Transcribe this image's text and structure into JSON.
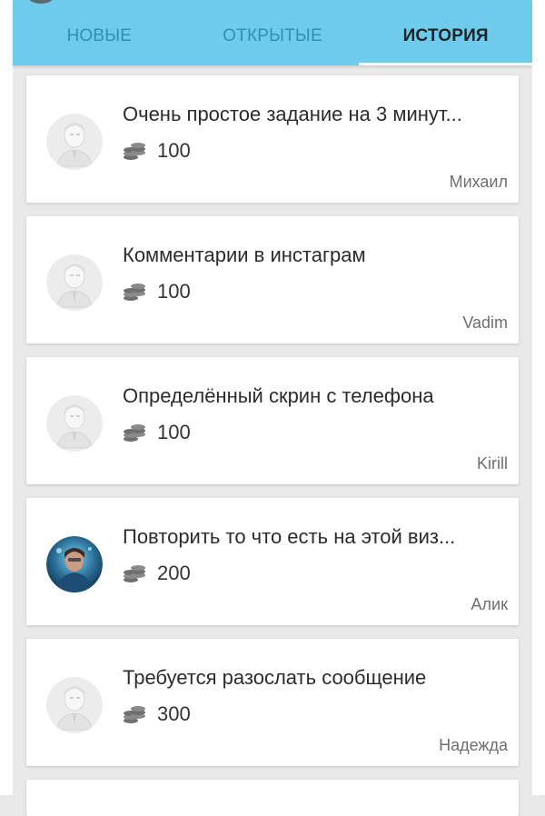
{
  "tabs": [
    {
      "label": "НОВЫЕ",
      "active": false
    },
    {
      "label": "ОТКРЫТЫЕ",
      "active": false
    },
    {
      "label": "ИСТОРИЯ",
      "active": true
    }
  ],
  "colors": {
    "header_bg": "#6fcbeb",
    "tab_inactive": "#2f8fb5",
    "tab_active": "#1d2327",
    "page_bg": "#e9e9e9"
  },
  "tasks": [
    {
      "title": "Очень простое задание на 3 минут...",
      "reward": "100",
      "author": "Михаил",
      "avatar": "placeholder-avatar-icon",
      "coin_icon": "coin-stack-icon"
    },
    {
      "title": "Комментарии в инстаграм",
      "reward": "100",
      "author": "Vadim",
      "avatar": "placeholder-avatar-icon",
      "coin_icon": "coin-stack-icon"
    },
    {
      "title": "Определённый скрин с телефона",
      "reward": "100",
      "author": "Kirill",
      "avatar": "placeholder-avatar-icon",
      "coin_icon": "coin-stack-icon"
    },
    {
      "title": "Повторить то что есть на этой виз...",
      "reward": "200",
      "author": "Алик",
      "avatar": "user-photo-avatar",
      "coin_icon": "coin-stack-icon"
    },
    {
      "title": "Требуется разослать сообщение",
      "reward": "300",
      "author": "Надежда",
      "avatar": "placeholder-avatar-icon",
      "coin_icon": "coin-stack-icon"
    }
  ]
}
